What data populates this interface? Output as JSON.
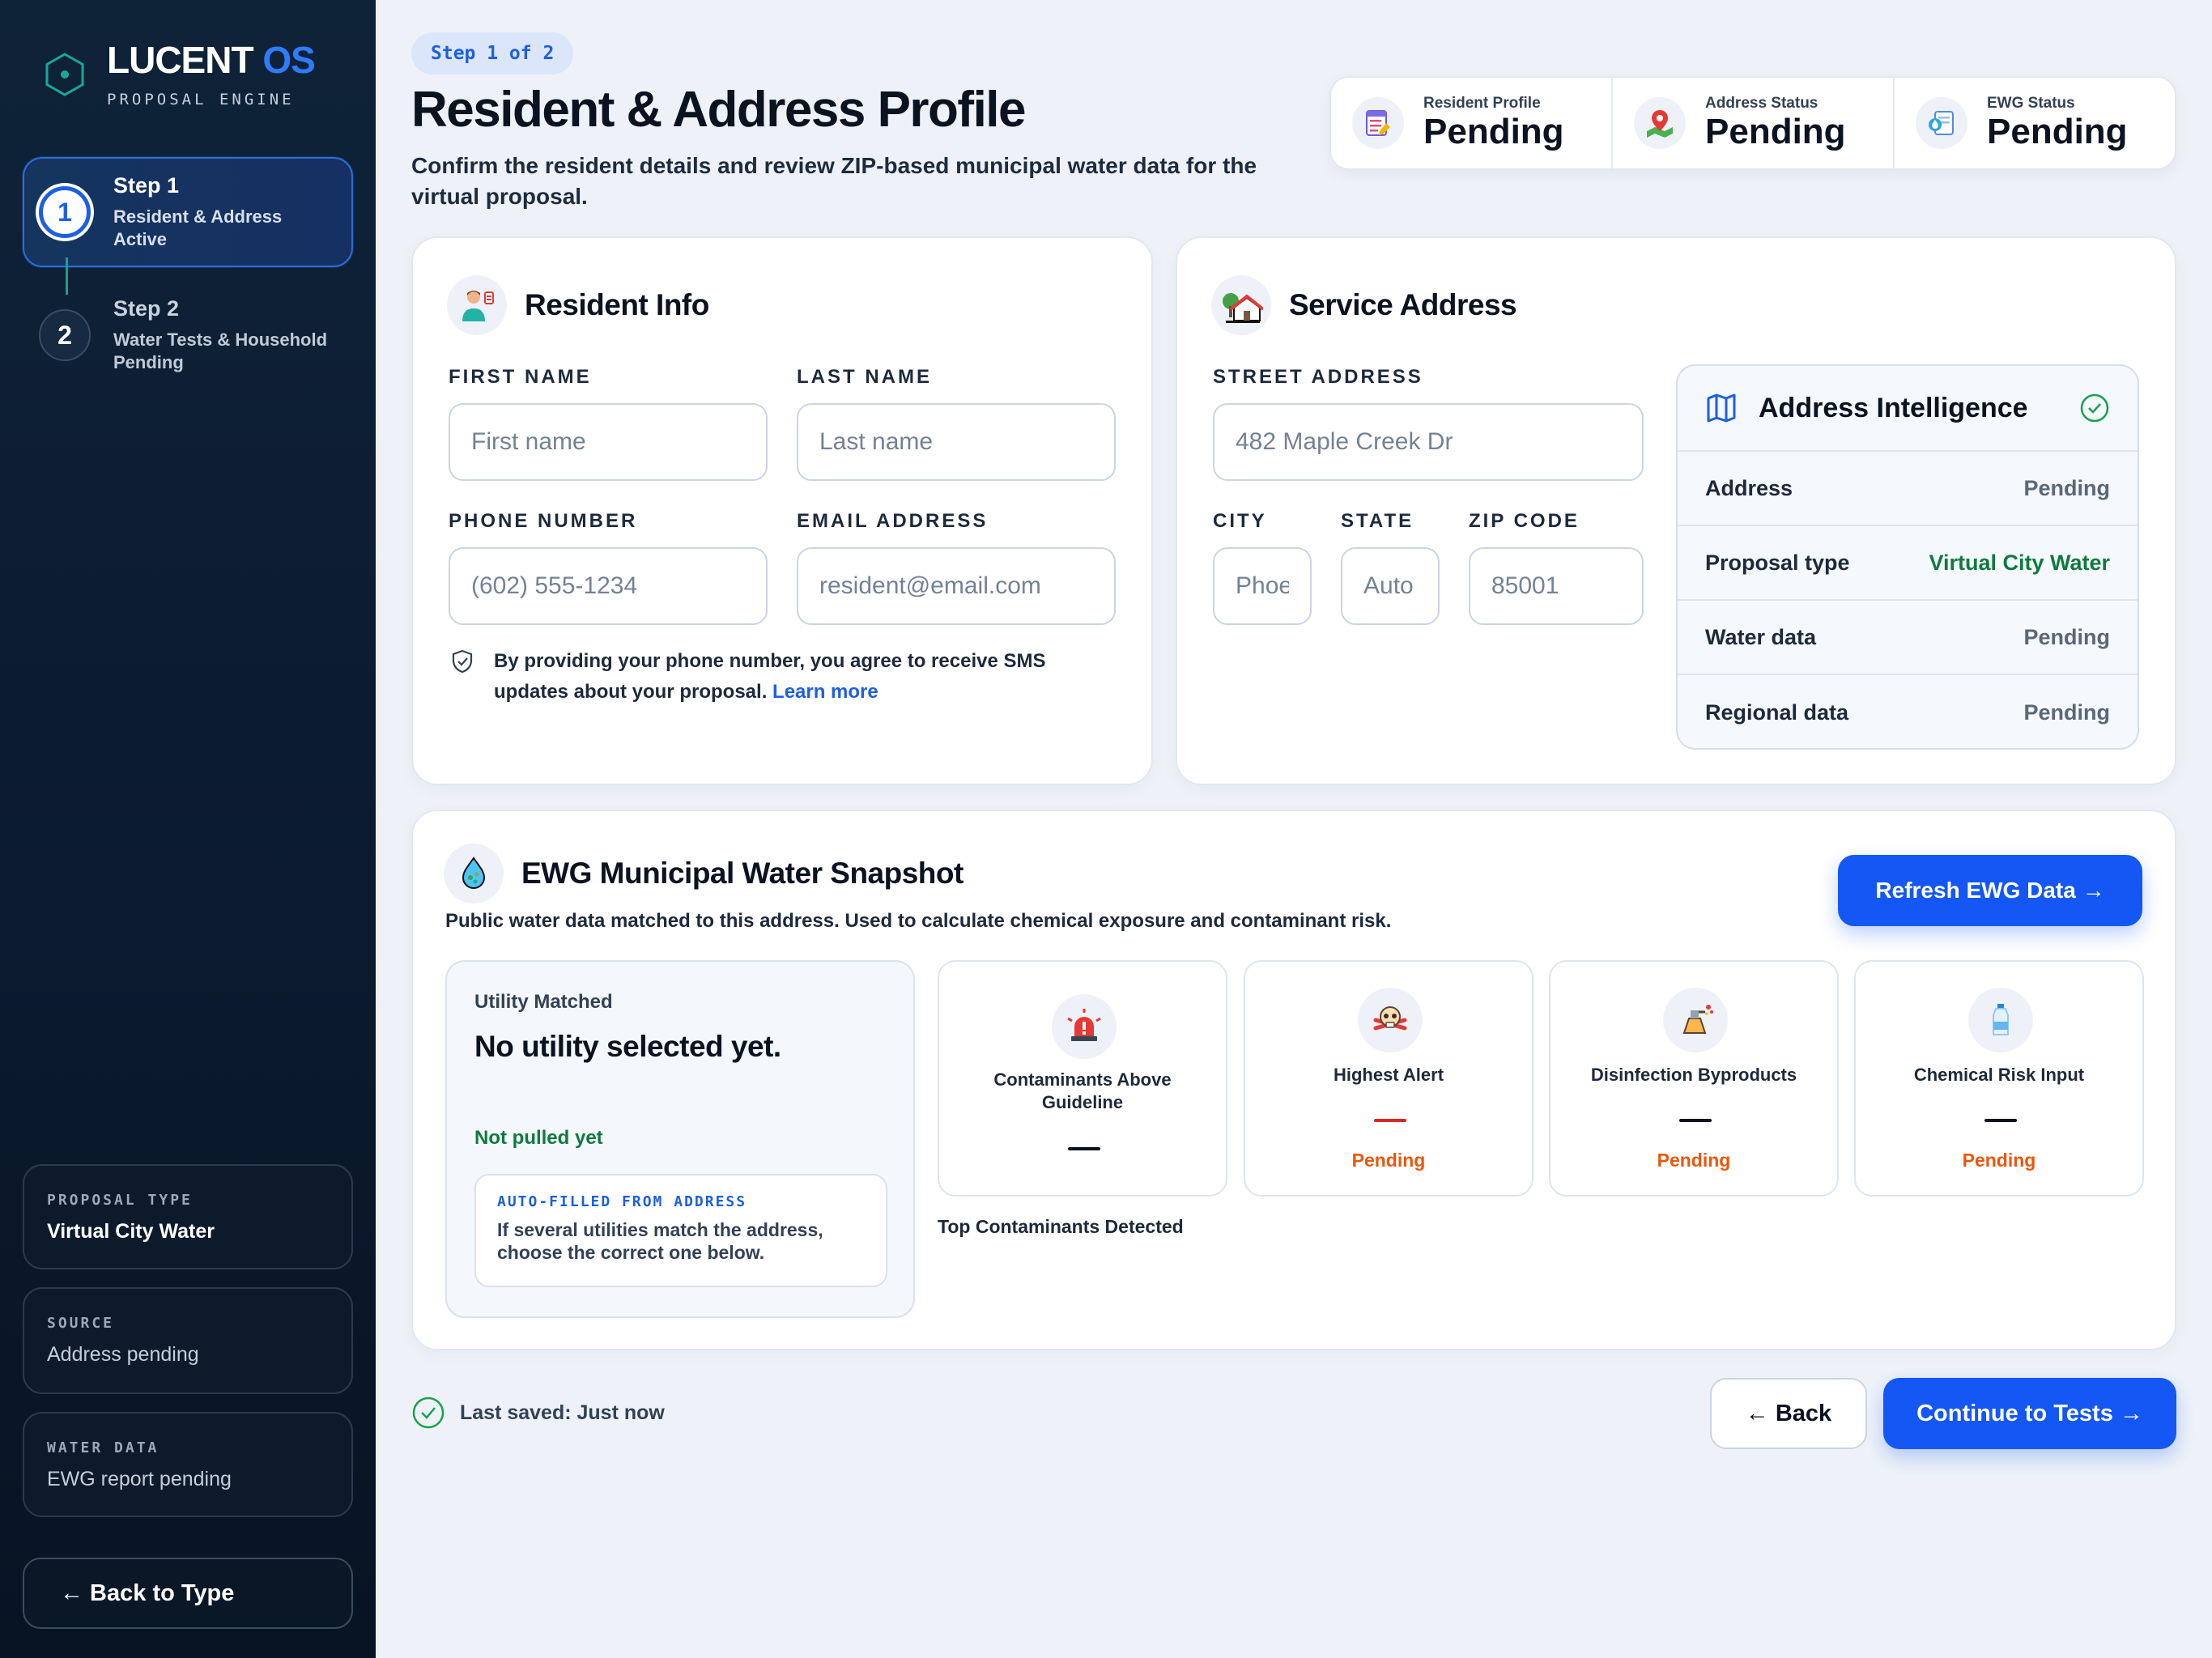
{
  "brand": {
    "name": "LUCENT",
    "name_accent": "OS",
    "subtitle": "PROPOSAL ENGINE"
  },
  "sidebar": {
    "steps": [
      {
        "number": "1",
        "title": "Step 1",
        "desc_line1": "Resident & Address",
        "desc_line2": "Active",
        "state": "active"
      },
      {
        "number": "2",
        "title": "Step 2",
        "desc_line1": "Water Tests & Household",
        "desc_line2": "Pending",
        "state": "pending"
      }
    ],
    "info_cards": [
      {
        "key": "PROPOSAL TYPE",
        "value": "Virtual City Water"
      },
      {
        "key": "SOURCE",
        "value": "Address pending"
      },
      {
        "key": "WATER DATA",
        "value": "EWG report pending"
      }
    ],
    "back_button": "← Back to Type"
  },
  "header": {
    "step_pill": "Step 1 of 2",
    "title": "Resident & Address Profile",
    "lead": "Confirm the resident details and review ZIP-based municipal water data for the virtual proposal."
  },
  "status": [
    {
      "label": "Resident Profile",
      "value": "Pending",
      "icon": "profile-form-icon"
    },
    {
      "label": "Address Status",
      "value": "Pending",
      "icon": "map-pin-icon"
    },
    {
      "label": "EWG Status",
      "value": "Pending",
      "icon": "water-report-icon"
    }
  ],
  "resident": {
    "title": "Resident Info",
    "first_name": {
      "label": "FIRST NAME",
      "placeholder": "First name",
      "value": ""
    },
    "last_name": {
      "label": "LAST NAME",
      "placeholder": "Last name",
      "value": ""
    },
    "phone": {
      "label": "PHONE NUMBER",
      "placeholder": "(602) 555-1234",
      "value": ""
    },
    "email": {
      "label": "EMAIL ADDRESS",
      "placeholder": "resident@email.com",
      "value": ""
    },
    "sms_notice_line1": "By providing your phone number, you agree to receive SMS",
    "sms_notice_line2": "updates about your proposal.",
    "learn_more": "Learn more"
  },
  "service_address": {
    "title": "Service Address",
    "street": {
      "label": "STREET ADDRESS",
      "placeholder": "482 Maple Creek Dr",
      "value": ""
    },
    "city": {
      "label": "CITY",
      "placeholder": "Phoenix",
      "value": ""
    },
    "state": {
      "label": "STATE",
      "placeholder": "Auto",
      "value": ""
    },
    "zip": {
      "label": "ZIP CODE",
      "placeholder": "85001",
      "value": ""
    }
  },
  "address_intelligence": {
    "title": "Address Intelligence",
    "rows": [
      {
        "key": "Address",
        "value": "Pending",
        "tone": "muted"
      },
      {
        "key": "Proposal type",
        "value": "Virtual City Water",
        "tone": "green"
      },
      {
        "key": "Water data",
        "value": "Pending",
        "tone": "muted"
      },
      {
        "key": "Regional data",
        "value": "Pending",
        "tone": "muted"
      }
    ]
  },
  "ewg": {
    "title": "EWG Municipal Water Snapshot",
    "subtitle": "Public water data matched to this address. Used to calculate chemical exposure and contaminant risk.",
    "refresh_button": "Refresh EWG Data →",
    "utility": {
      "label": "Utility Matched",
      "value": "No utility selected yet.",
      "status": "Not pulled yet",
      "auto_key": "AUTO-FILLED FROM ADDRESS",
      "auto_line1": "If several utilities match the address,",
      "auto_line2": "choose the correct one below."
    },
    "metrics": [
      {
        "label_line1": "Contaminants Above",
        "label_line2": "Guideline",
        "value": "—",
        "status": "",
        "icon": "alarm-siren-icon"
      },
      {
        "label_line1": "Highest Alert",
        "label_line2": "",
        "value": "—",
        "status": "Pending",
        "icon": "skull-crossbones-icon"
      },
      {
        "label_line1": "Disinfection Byproducts",
        "label_line2": "",
        "value": "—",
        "status": "Pending",
        "icon": "chemical-spray-icon"
      },
      {
        "label_line1": "Chemical Risk Input",
        "label_line2": "",
        "value": "—",
        "status": "Pending",
        "icon": "bottle-icon"
      }
    ],
    "top_contaminants": "Top Contaminants Detected"
  },
  "footer": {
    "saved": "Last saved: Just now",
    "back_button": "← Back",
    "continue_button": "Continue to Tests →"
  },
  "colors": {
    "accent": "#1457f5",
    "sidebar": "#0b1a2e",
    "success": "#0f7a3e",
    "warning": "#ea580c",
    "danger": "#e02424"
  }
}
